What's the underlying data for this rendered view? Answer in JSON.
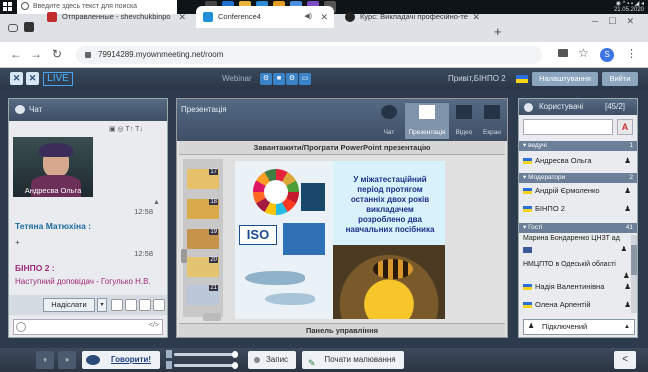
{
  "taskbar": {
    "search_placeholder": "Введите здесь текст для поиска",
    "clock": "21.05.2020"
  },
  "browser": {
    "tabs": [
      {
        "label": "Отправленные - shevchukbinpo",
        "favicon": "#c22c2c"
      },
      {
        "label": "Conference4",
        "favicon": "#1e90d8"
      },
      {
        "label": "Курс: Викладачі професійно-те",
        "favicon": "#222222"
      }
    ],
    "url": "79914289.myownmeeting.net/room",
    "profile_letter": "S"
  },
  "app": {
    "live_label": "LIVE",
    "webinar_label": "Webinar",
    "greeting": "Привіт,БІНПО 2",
    "settings_button": "Налаштування",
    "exit_button": "Вийти"
  },
  "chat": {
    "title": "Чат",
    "video_caption": "Андресва Ольга",
    "messages": [
      {
        "time": "12:58",
        "author": "Тетяна Матюхіна :",
        "text": "+"
      },
      {
        "time": "12:58",
        "author": "БІНПО 2 :",
        "text": "Наступний доповідач - Гогулько Н.В."
      }
    ],
    "send_button": "Надіслати"
  },
  "presentation": {
    "title": "Презентація",
    "modes": [
      "Чат",
      "Презентація",
      "Відео",
      "Екран"
    ],
    "upload_bar": "Завантажити/Програти PowerPoint презентацію",
    "control_bar": "Панель управління",
    "thumb_numbers": [
      "17",
      "18",
      "19",
      "20",
      "21"
    ],
    "slide_text": "У міжатестаційний період протягом останніх двох років викладачем розроблено два навчальних посібника",
    "iso_label": "ISO"
  },
  "users": {
    "title": "Користувачі",
    "count": "[45/2]",
    "groups": [
      {
        "name": "ведучі",
        "count": "1",
        "members": [
          "Андресва Ольга"
        ]
      },
      {
        "name": "Модератори",
        "count": "2",
        "members": [
          "Андрій Єрмоленко",
          "БІНПО 2"
        ]
      },
      {
        "name": "Гості",
        "count": "41",
        "members": [
          "Марина Бондаренко ЦНЗТ ад",
          "НМЦПТО в Одеській області",
          "Надія Валентинівна",
          "Олена Арпентій"
        ]
      }
    ],
    "status_button": "Підключений"
  },
  "bottombar": {
    "talk_button": "Говорити!",
    "record_button": "Запис",
    "draw_button": "Почати малювання"
  }
}
